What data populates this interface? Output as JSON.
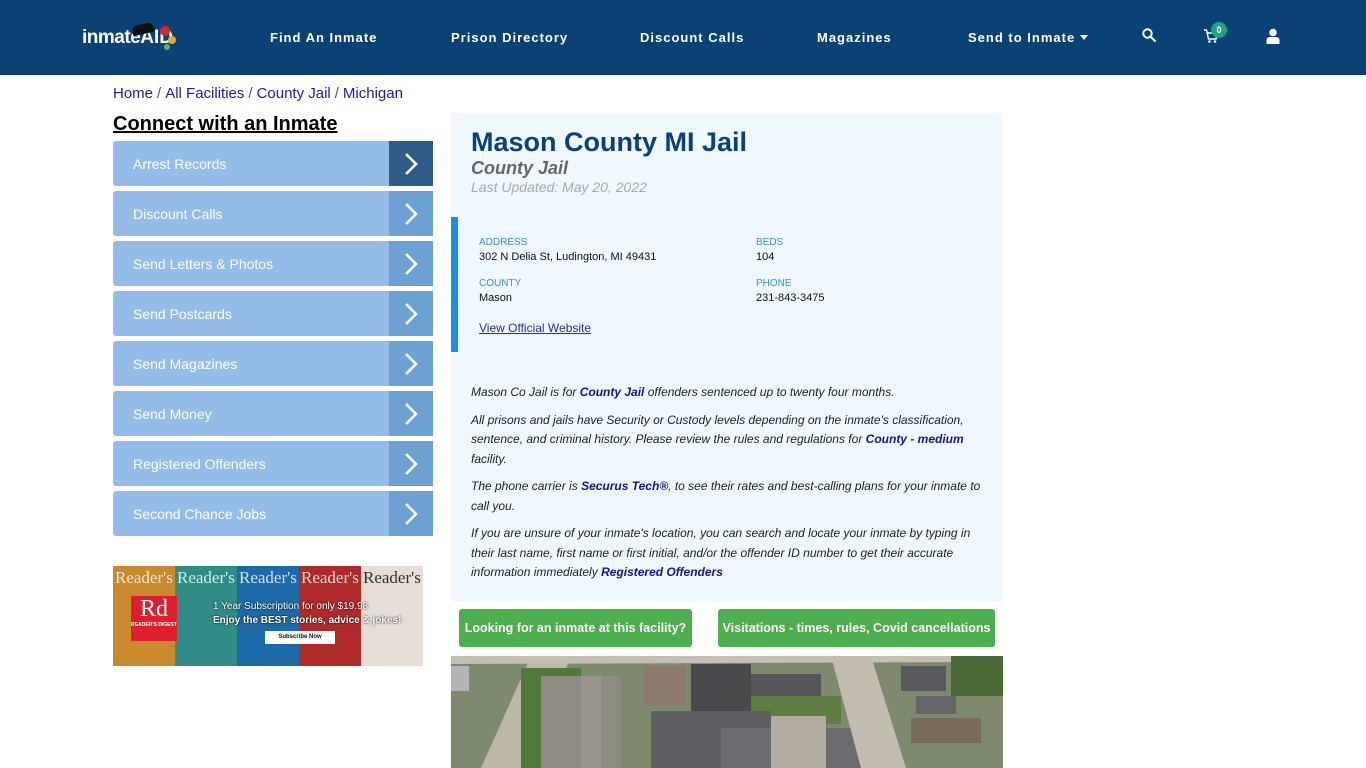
{
  "header": {
    "logo_text": "inmate",
    "logo_accent": "AID",
    "nav": [
      {
        "label": "Find An Inmate"
      },
      {
        "label": "Prison Directory"
      },
      {
        "label": "Discount Calls"
      },
      {
        "label": "Magazines"
      },
      {
        "label": "Send to Inmate",
        "has_dropdown": true
      }
    ],
    "icons": [
      "search-icon",
      "cart-icon",
      "user-icon"
    ],
    "cart_count": "0",
    "colors": {
      "bg": "#0b4275",
      "badge": "#1fa67a"
    }
  },
  "breadcrumb": [
    {
      "label": "Home"
    },
    {
      "label": "All Facilities"
    },
    {
      "label": "County Jail"
    },
    {
      "label": "Michigan"
    }
  ],
  "breadcrumb_separator": "/",
  "sidebar": {
    "title": "Connect with an Inmate",
    "items": [
      {
        "label": "Arrest Records",
        "active": true
      },
      {
        "label": "Discount Calls"
      },
      {
        "label": "Send Letters & Photos"
      },
      {
        "label": "Send Postcards"
      },
      {
        "label": "Send Magazines"
      },
      {
        "label": "Send Money"
      },
      {
        "label": "Registered Offenders"
      },
      {
        "label": "Second Chance Jobs"
      }
    ]
  },
  "ad": {
    "brand": "Rd",
    "brand_name": "READER'S DIGEST",
    "cover_title": "Reader's",
    "line1": "1 Year Subscription for only $19.98",
    "line2": "Enjoy the BEST stories, advice & jokes!",
    "button": "Subscribe Now"
  },
  "facility": {
    "name": "Mason County MI Jail",
    "type": "County Jail",
    "last_updated": "Last Updated: May 20, 2022",
    "address_label": "ADDRESS",
    "address": "302 N Delia St, Ludington, MI 49431",
    "beds_label": "BEDS",
    "beds": "104",
    "county_label": "COUNTY",
    "county": "Mason",
    "phone_label": "PHONE",
    "phone": "231-843-3475",
    "website_link": "View Official Website"
  },
  "description": {
    "p1_pre": "Mason Co Jail is for ",
    "p1_link": "County Jail",
    "p1_post": " offenders sentenced up to twenty four months.",
    "p2_pre": "All prisons and jails have Security or Custody levels depending on the inmate's classification, sentence, and criminal history. Please review the rules and regulations for ",
    "p2_link": "County - medium",
    "p2_post": " facility.",
    "p3_pre": "The phone carrier is ",
    "p3_link": "Securus Tech®",
    "p3_post": ", to see their rates and best-calling plans for your inmate to call you.",
    "p4_pre": "If you are unsure of your inmate's location, you can search and locate your inmate by typing in their last name, first name or first initial, and/or the offender ID number to get their accurate information immediately ",
    "p4_link": "Registered Offenders"
  },
  "actions": {
    "find_inmate": "Looking for an inmate at this facility?",
    "visitations": "Visitations - times, rules, Covid cancellations"
  }
}
